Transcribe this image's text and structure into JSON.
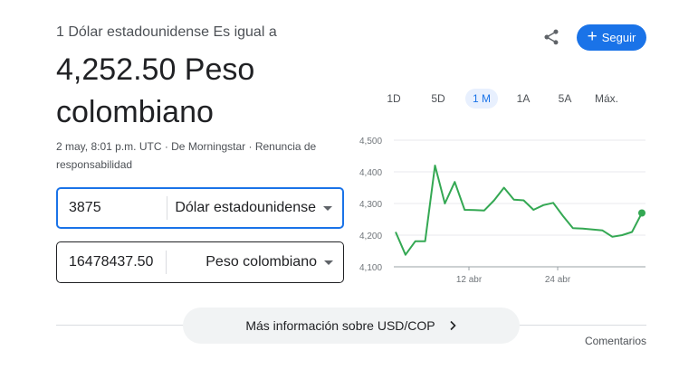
{
  "converter": {
    "subtitle": "1 Dólar estadounidense Es igual a",
    "result": "4,252.50 Peso colombiano",
    "meta": "2 may, 8:01 p.m. UTC · De Morningstar · Renuncia de responsabilidad",
    "from": {
      "amount": "3875",
      "currency": "Dólar estadounidense"
    },
    "to": {
      "amount": "16478437.50",
      "currency": "Peso colombiano"
    }
  },
  "actions": {
    "share_icon": "share-icon",
    "follow_label": "Seguir",
    "follow_icon": "plus-icon"
  },
  "time_ranges": {
    "items": [
      "1D",
      "5D",
      "1 M",
      "1A",
      "5A",
      "Máx."
    ],
    "selected": "1 M"
  },
  "colors": {
    "accent": "#1a73e8",
    "line": "#34a853",
    "selected_range_bg": "#e8f0fe"
  },
  "chart_data": {
    "type": "line",
    "x_ticks": [
      "12 abr",
      "24 abr"
    ],
    "y_ticks": [
      "4,500",
      "4,400",
      "4,300",
      "4,200",
      "4,100"
    ],
    "ylim": [
      4100,
      4500
    ],
    "grid": true,
    "series": [
      {
        "values": [
          4210,
          4138,
          4181,
          4181,
          4420,
          4300,
          4368,
          4280,
          4279,
          4278,
          4310,
          4350,
          4312,
          4310,
          4280,
          4295,
          4302,
          4260,
          4222,
          4221,
          4218,
          4215,
          4195,
          4200,
          4210,
          4270
        ]
      }
    ]
  },
  "footer": {
    "more_info": "Más información sobre USD/COP",
    "more_icon": "chevron-right-icon",
    "feedback": "Comentarios"
  }
}
